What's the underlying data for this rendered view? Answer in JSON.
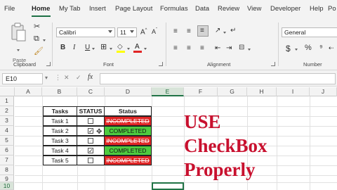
{
  "menu": {
    "tabs": [
      "File",
      "Home",
      "My Tab",
      "Insert",
      "Page Layout",
      "Formulas",
      "Data",
      "Review",
      "View",
      "Developer",
      "Help",
      "Po"
    ]
  },
  "ribbon": {
    "clipboard_label": "Clipboard",
    "paste_label": "Paste",
    "font_label": "Font",
    "alignment_label": "Alignment",
    "number_label": "Number",
    "font_name": "Calibri",
    "font_size": "11",
    "number_format": "General",
    "bold": "B",
    "italic": "I",
    "underline": "U",
    "currency": "$",
    "percent": "%"
  },
  "formula_bar": {
    "name_box": "E10",
    "fx": "fx",
    "cancel": "✕",
    "enter": "✓",
    "dots": "⋮"
  },
  "grid": {
    "columns": [
      "A",
      "B",
      "C",
      "D",
      "E",
      "F",
      "G",
      "H",
      "I",
      "J"
    ],
    "rows": [
      "1",
      "2",
      "3",
      "4",
      "5",
      "6",
      "7",
      "8",
      "9",
      "10"
    ],
    "selected_column": "E",
    "selected_row": "10"
  },
  "table": {
    "headers": {
      "tasks": "Tasks",
      "status_chk": "STATUS",
      "status": "Status"
    },
    "rows": [
      {
        "task": "Task 1",
        "checked": false,
        "status": "INCOMPLETED"
      },
      {
        "task": "Task 2",
        "checked": true,
        "status": "COMPLETED"
      },
      {
        "task": "Task 3",
        "checked": false,
        "status": "INCOMPLETED"
      },
      {
        "task": "Task 4",
        "checked": true,
        "status": "COMPLETED"
      },
      {
        "task": "Task 5",
        "checked": false,
        "status": "INCOMPLETED"
      }
    ]
  },
  "overlay": {
    "line1": "USE",
    "line2": "CheckBox",
    "line3": "Properly"
  },
  "colors": {
    "accent": "#217346",
    "completed": "#4ecb3f",
    "incompleted": "#e02424",
    "overlay_text": "#c8102e"
  }
}
